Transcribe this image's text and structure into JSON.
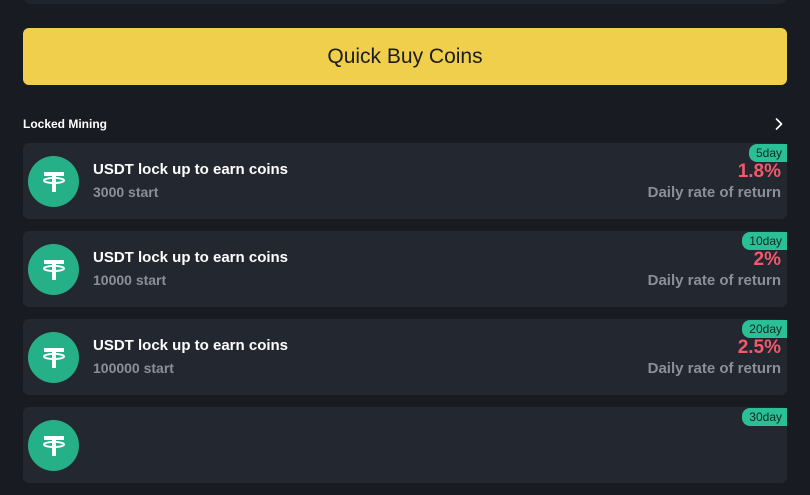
{
  "quick_buy": {
    "label": "Quick Buy Coins"
  },
  "locked_mining": {
    "title": "Locked Mining",
    "items": [
      {
        "title": "USDT lock up to earn coins",
        "start": "3000 start",
        "days": "5day",
        "rate": "1.8%",
        "rate_label": "Daily rate of return"
      },
      {
        "title": "USDT lock up to earn coins",
        "start": "10000 start",
        "days": "10day",
        "rate": "2%",
        "rate_label": "Daily rate of return"
      },
      {
        "title": "USDT lock up to earn coins",
        "start": "100000 start",
        "days": "20day",
        "rate": "2.5%",
        "rate_label": "Daily rate of return"
      },
      {
        "days": "30day"
      }
    ]
  },
  "colors": {
    "background": "#181b22",
    "card": "#23272f",
    "accent_yellow": "#efcf4c",
    "tether_green": "#26b088",
    "badge_green": "#2bbf96",
    "rate_red": "#f05a6a"
  },
  "icons": {
    "coin": "tether-icon",
    "more": "chevron-right-icon"
  }
}
